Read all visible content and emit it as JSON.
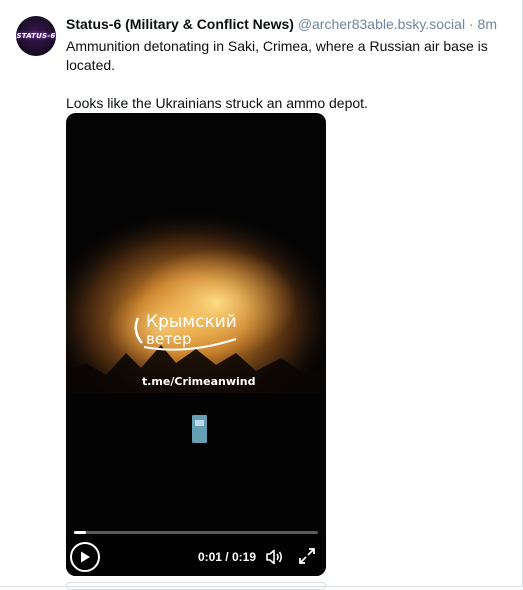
{
  "post": {
    "avatar_text": "STATUS-6",
    "author": "Status-6 (Military & Conflict News)",
    "handle": "@archer83able.bsky.social",
    "separator": "·",
    "time": "8m",
    "text_line1": "Ammunition detonating in Saki, Crimea, where a Russian air base is located.",
    "text_line2": "Looks like the Ukrainians struck an ammo depot."
  },
  "video": {
    "watermark_line1": "Крымский",
    "watermark_line2": "ветер",
    "watermark_url": "t.me/Crimeanwind",
    "timecode": "0:01 / 0:19",
    "progress": 0.05
  },
  "icons": {
    "play": "play-icon",
    "volume": "volume-icon",
    "fullscreen": "fullscreen-icon"
  },
  "colors": {
    "handle": "#6f869f",
    "text": "#0b0f14",
    "fire": "#e8a23a"
  }
}
